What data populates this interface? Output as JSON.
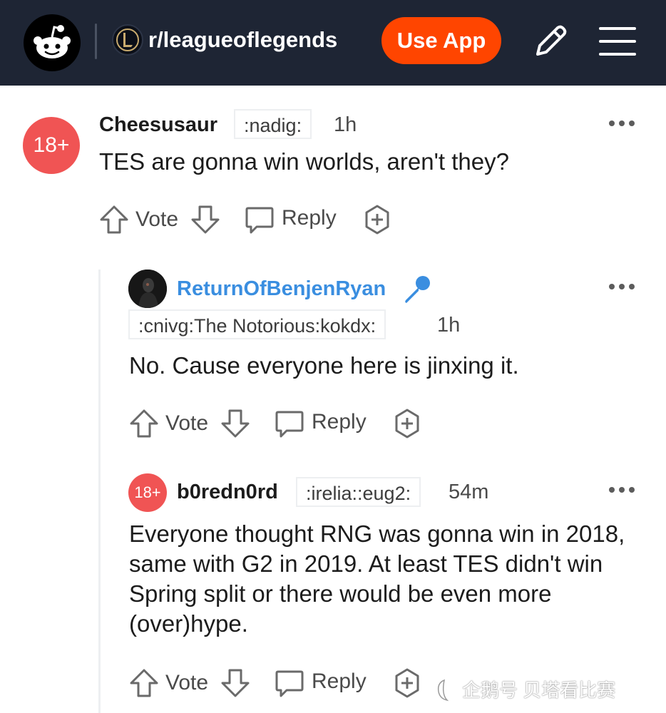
{
  "header": {
    "subreddit": "r/leagueoflegends",
    "use_app_label": "Use App",
    "icons": [
      "reddit-snoo-icon",
      "league-of-legends-icon",
      "pencil-icon",
      "hamburger-menu-icon"
    ],
    "background_color": "#1e2534",
    "accent_color": "#ff4500"
  },
  "comments": [
    {
      "avatar_badge": "18+",
      "username": "Cheesusaur",
      "flair": ":nadig:",
      "time": "1h",
      "body": "TES are gonna win worlds, aren't they?",
      "actions": {
        "vote": "Vote",
        "reply": "Reply"
      }
    },
    {
      "username": "ReturnOfBenjenRyan",
      "flair": ":cnivg:The Notorious:kokdx:",
      "time": "1h",
      "body": "No. Cause everyone here is jinxing it.",
      "actions": {
        "vote": "Vote",
        "reply": "Reply"
      },
      "icons": [
        "microphone-icon"
      ]
    },
    {
      "avatar_badge": "18+",
      "username": "b0redn0rd",
      "flair": ":irelia::eug2:",
      "time": "54m",
      "body": "Everyone thought RNG was gonna win in 2018, same with G2 in 2019. At least TES didn't win Spring split or there would be even more (over)hype.",
      "actions": {
        "vote": "Vote",
        "reply": "Reply"
      }
    }
  ],
  "watermark": "企鹅号 贝塔看比赛",
  "colors": {
    "username_highlight": "#3a8ee0",
    "badge": "#f05454"
  }
}
